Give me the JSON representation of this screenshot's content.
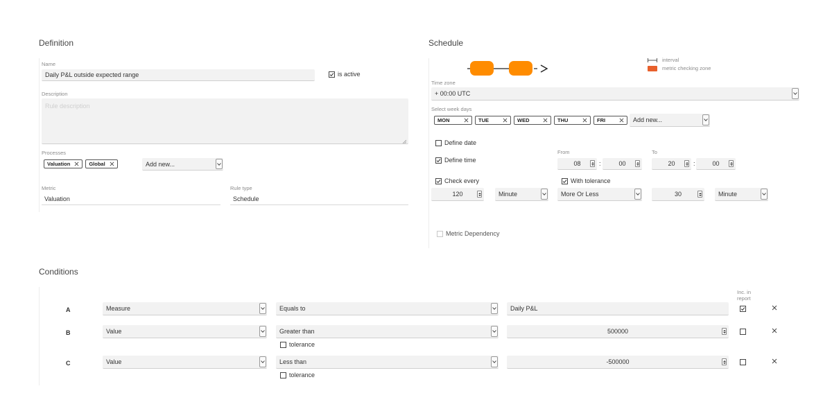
{
  "definition": {
    "title": "Definition",
    "name_label": "Name",
    "name_value": "Daily P&L outside expected range",
    "is_active_label": "is active",
    "description_label": "Description",
    "description_placeholder": "Rule description",
    "processes_label": "Processes",
    "processes": [
      "Valuation",
      "Global"
    ],
    "processes_add_placeholder": "Add new...",
    "metric_label": "Metric",
    "metric_value": "Valuation",
    "rule_type_label": "Rule type",
    "rule_type_value": "Schedule"
  },
  "schedule": {
    "title": "Schedule",
    "legend_interval": "interval",
    "legend_zone": "metric checking zone",
    "timezone_label": "Time zone",
    "timezone_value": "+ 00:00 UTC",
    "weekdays_label": "Select week days",
    "weekdays": [
      "MON",
      "TUE",
      "WED",
      "THU",
      "FRI"
    ],
    "weekdays_add_placeholder": "Add new...",
    "define_date_label": "Define date",
    "define_time_label": "Define time",
    "from_label": "From",
    "to_label": "To",
    "from_hour": "08",
    "from_minute": "00",
    "to_hour": "20",
    "to_minute": "00",
    "time_separator": ":",
    "check_every_label": "Check every",
    "check_every_value": "120",
    "check_every_unit": "Minute",
    "with_tolerance_label": "With tolerance",
    "tolerance_mode": "More Or Less",
    "tolerance_value": "30",
    "tolerance_unit": "Minute",
    "metric_dependency_label": "Metric Dependency",
    "zone_color": "#ff8c00"
  },
  "conditions": {
    "title": "Conditions",
    "inc_report_label_1": "Inc. in",
    "inc_report_label_2": "report",
    "tolerance_label": "tolerance",
    "rows": [
      {
        "letter": "A",
        "type": "Measure",
        "operator": "Equals to",
        "value": "Daily P&L"
      },
      {
        "letter": "B",
        "type": "Value",
        "operator": "Greater than",
        "value": "500000"
      },
      {
        "letter": "C",
        "type": "Value",
        "operator": "Less than",
        "value": "-500000"
      }
    ]
  }
}
